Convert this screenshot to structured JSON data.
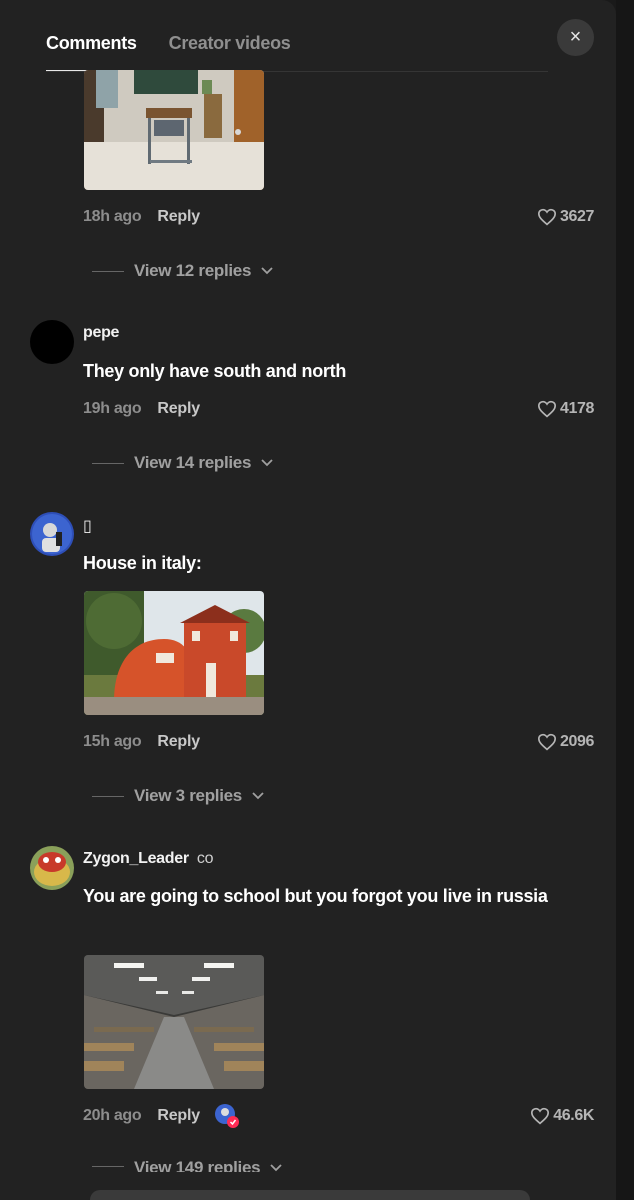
{
  "tabs": [
    {
      "label": "Comments",
      "active": true
    },
    {
      "label": "Creator videos",
      "active": false
    }
  ],
  "close_label": "×",
  "comments": [
    {
      "username": "",
      "text": "",
      "time": "18h ago",
      "reply": "Reply",
      "likes": "3627",
      "view_replies": "View 12 replies",
      "image": "classroom-desk-photo"
    },
    {
      "username": "pepe",
      "text": "They only have south and north",
      "time": "19h ago",
      "reply": "Reply",
      "likes": "4178",
      "view_replies": "View 14 replies"
    },
    {
      "username": "▯",
      "text": "House in italy:",
      "time": "15h ago",
      "reply": "Reply",
      "likes": "2096",
      "view_replies": "View 3 replies",
      "image": "orange-shoe-house-photo"
    },
    {
      "username": "Zygon_Leader",
      "username_suffix": "co",
      "text": "You are going to school but you forgot you live in russia",
      "time": "20h ago",
      "reply": "Reply",
      "likes": "46.6K",
      "view_replies": "View 149 replies",
      "image": "huge-exam-hall-photo"
    }
  ],
  "colors": {
    "panel": "#222222",
    "text": "#ffffff",
    "muted": "#8d8d8d"
  }
}
